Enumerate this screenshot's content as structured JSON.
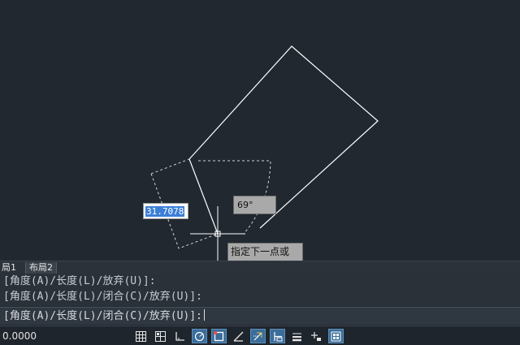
{
  "drawing": {
    "length_input_value": "31.7078",
    "angle_tooltip": "69°",
    "prompt_tooltip": "指定下一点或"
  },
  "layout_tabs": [
    {
      "label": "局1"
    },
    {
      "label": "布局2"
    }
  ],
  "command_history": [
    "[角度(A)/长度(L)/放弃(U)]:",
    "[角度(A)/长度(L)/闭合(C)/放弃(U)]:"
  ],
  "command_line": {
    "text": "[角度(A)/长度(L)/闭合(C)/放弃(U)]:"
  },
  "status_bar": {
    "coordinates": "0.0000",
    "buttons": [
      {
        "icon": "grid-icon",
        "active": false
      },
      {
        "icon": "snap-grid-icon",
        "active": false
      },
      {
        "icon": "ortho-icon",
        "active": false
      },
      {
        "icon": "polar-tracking-icon",
        "active": true
      },
      {
        "icon": "object-snap-icon",
        "active": true
      },
      {
        "icon": "isometric-icon",
        "active": false
      },
      {
        "icon": "object-snap-tracking-icon",
        "active": true
      },
      {
        "icon": "dynamic-input-icon",
        "active": true
      },
      {
        "icon": "lineweight-icon",
        "active": false
      },
      {
        "icon": "transparency-icon",
        "active": false
      },
      {
        "icon": "workspace-icon",
        "active": true
      }
    ]
  },
  "colors": {
    "canvas_background": "#212830",
    "geometry": "#ffffff",
    "selection": "#3b7fd6",
    "active_toggle": "#3b6d9a"
  }
}
